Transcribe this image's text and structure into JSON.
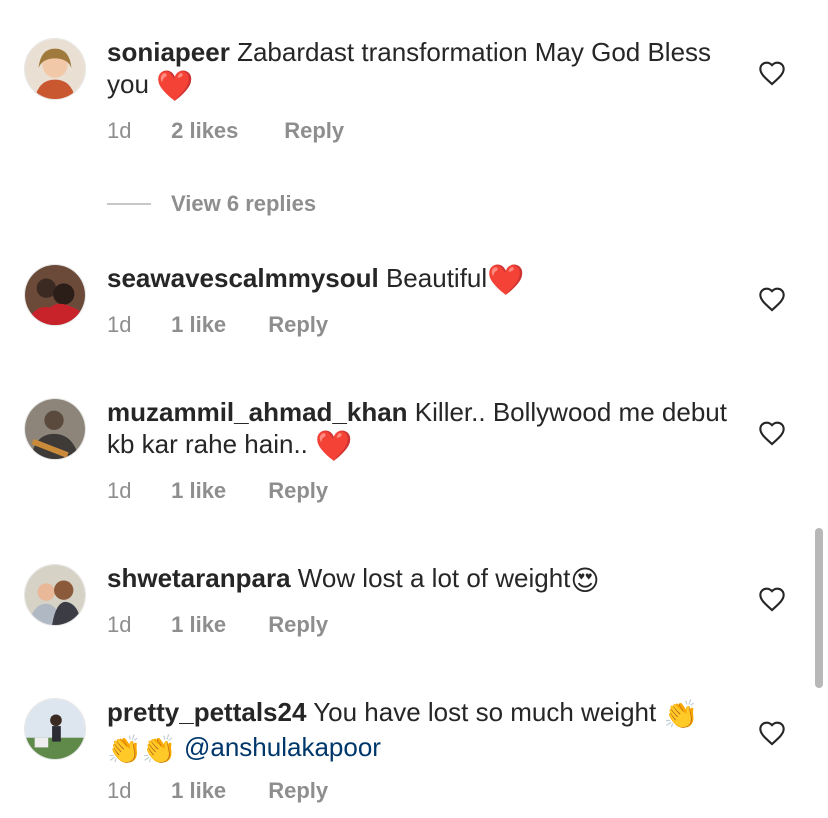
{
  "comments": [
    {
      "username": "soniapeer",
      "text": "Zabardast transformation May God Bless you",
      "emoji": "❤️",
      "time": "1d",
      "likes": "2 likes",
      "reply": "Reply",
      "view_replies": "View 6 replies"
    },
    {
      "username": "seawavescalmmysoul",
      "text": "Beautiful",
      "emoji": "❤️",
      "time": "1d",
      "likes": "1 like",
      "reply": "Reply"
    },
    {
      "username": "muzammil_ahmad_khan",
      "text": "Killer.. Bollywood me debut kb kar rahe hain..",
      "emoji": "❤️",
      "time": "1d",
      "likes": "1 like",
      "reply": "Reply"
    },
    {
      "username": "shwetaranpara",
      "text": "Wow lost a lot of weight",
      "emoji": "😍",
      "time": "1d",
      "likes": "1 like",
      "reply": "Reply"
    },
    {
      "username": "pretty_pettals24",
      "text": "You have lost so much weight",
      "emoji": "👏👏👏",
      "mention": "@anshulakapoor",
      "time": "1d",
      "likes": "1 like",
      "reply": "Reply"
    }
  ],
  "icons": {
    "like": "heart-outline-icon"
  },
  "colors": {
    "text": "#262626",
    "secondary": "#8e8e8e",
    "mention": "#00376b",
    "heart": "#ed2939"
  }
}
